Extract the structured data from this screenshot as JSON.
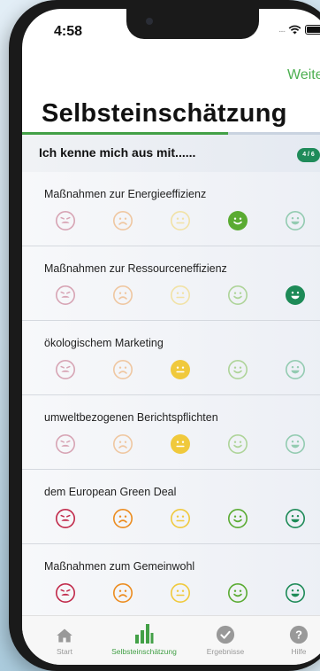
{
  "status": {
    "time": "4:58",
    "signal": "...."
  },
  "nav": {
    "next_label": "Weiter"
  },
  "page": {
    "title": "Selbsteinschätzung"
  },
  "progress": {
    "current": 4,
    "total": 6,
    "badge": "4 / 6",
    "fraction": 0.667
  },
  "section": {
    "label": "Ich kenne mich aus mit......"
  },
  "items": [
    {
      "label": "Maßnahmen zur Energieeffizienz",
      "selected": 4
    },
    {
      "label": "Maßnahmen zur Ressourceneffizienz",
      "selected": 5
    },
    {
      "label": "ökologischem Marketing",
      "selected": 3
    },
    {
      "label": "umweltbezogenen Berichtspflichten",
      "selected": 3
    },
    {
      "label": "dem European Green Deal",
      "selected": 0
    },
    {
      "label": "Maßnahmen zum Gemeinwohl",
      "selected": 0
    }
  ],
  "rating_scale": [
    {
      "icon": "very-sad-face-icon",
      "color": "#c1294a",
      "faded": "#d7a4b4"
    },
    {
      "icon": "sad-face-icon",
      "color": "#ec8c1f",
      "faded": "#efc7a1"
    },
    {
      "icon": "neutral-face-icon",
      "color": "#f0c93c",
      "faded": "#f1e2a6"
    },
    {
      "icon": "happy-face-icon",
      "color": "#5aab32",
      "faded": "#aed499"
    },
    {
      "icon": "very-happy-face-icon",
      "color": "#1d8a57",
      "faded": "#93cbb1"
    }
  ],
  "tabs": [
    {
      "label": "Start",
      "icon": "home-icon",
      "active": false
    },
    {
      "label": "Selbsteinschätzung",
      "icon": "bar-chart-icon",
      "active": true
    },
    {
      "label": "Ergebnisse",
      "icon": "checkmark-icon",
      "active": false
    },
    {
      "label": "Hilfe",
      "icon": "help-icon",
      "active": false
    }
  ],
  "colors": {
    "accent": "#43a047",
    "badge": "#1f8b5a",
    "inactive_tab": "#999999"
  }
}
